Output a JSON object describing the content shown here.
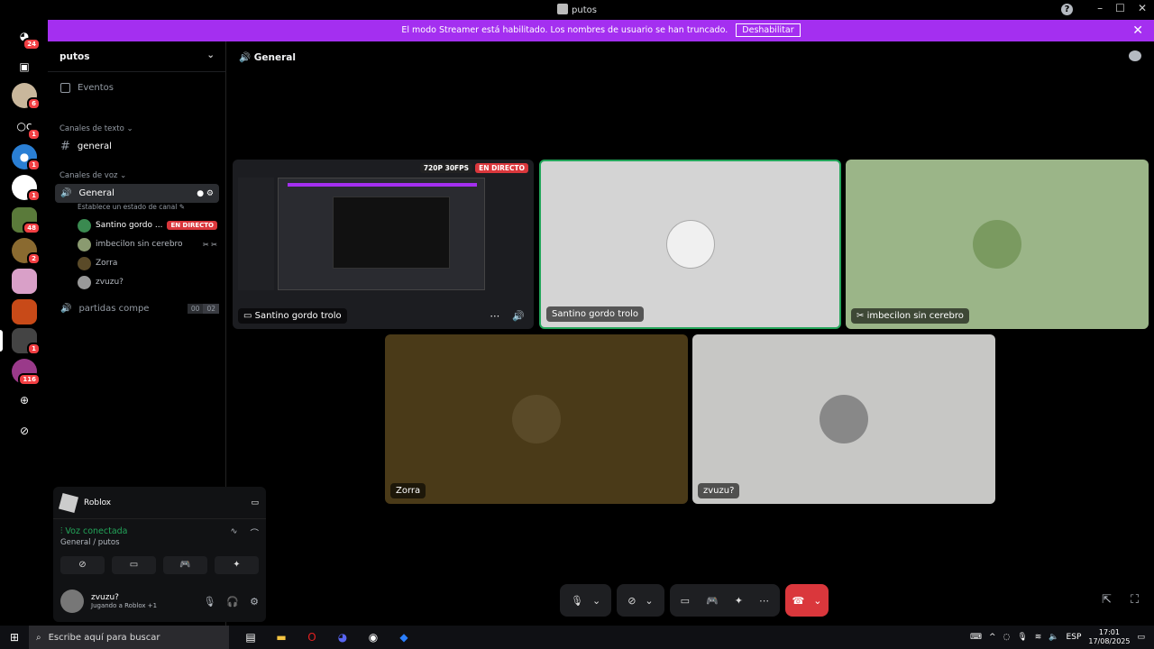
{
  "window": {
    "title": "putos"
  },
  "banner": {
    "text": "El modo Streamer está habilitado. Los nombres de usuario se han truncado.",
    "button": "Deshabilitar"
  },
  "servers": {
    "badges": [
      "24",
      "6",
      "1",
      "1",
      "1",
      "48",
      "2",
      "1",
      "116"
    ]
  },
  "guild": {
    "name": "putos",
    "events_label": "Eventos",
    "text_category": "Canales de texto",
    "text_channel": "general",
    "voice_category": "Canales de voz",
    "voice_channel": "General",
    "voice_status": "Establece un estado de canal",
    "users": [
      {
        "name": "Santino gordo ...",
        "badge": "EN DIRECTO"
      },
      {
        "name": "imbecilon sin cerebro"
      },
      {
        "name": "Zorra"
      },
      {
        "name": "zvuzu?"
      }
    ],
    "channel2": "partidas compe",
    "channel2_counts": [
      "00",
      "02"
    ]
  },
  "activity": {
    "game": "Roblox",
    "connected": "Voz conectada",
    "location": "General / putos"
  },
  "user": {
    "name": "zvuzu?",
    "status": "Jugando a Roblox +1"
  },
  "header": {
    "channel": "General"
  },
  "tiles": {
    "stream": {
      "name": "Santino gordo trolo",
      "quality": "720P 30FPS",
      "live": "EN DIRECTO"
    },
    "t2": {
      "name": "Santino gordo trolo",
      "bg": "#d4d4d4"
    },
    "t3": {
      "name": "imbecilon sin cerebro",
      "bg": "#9bb588"
    },
    "t4": {
      "name": "Zorra",
      "bg": "#4a3a18"
    },
    "t5": {
      "name": "zvuzu?",
      "bg": "#c7c7c5"
    }
  },
  "taskbar": {
    "search": "Escribe aquí para buscar",
    "lang": "ESP",
    "time": "17:01",
    "date": "17/08/2025"
  },
  "colors": {
    "accent": "#a42ff0",
    "live": "#da373c",
    "connected": "#23a55a"
  }
}
